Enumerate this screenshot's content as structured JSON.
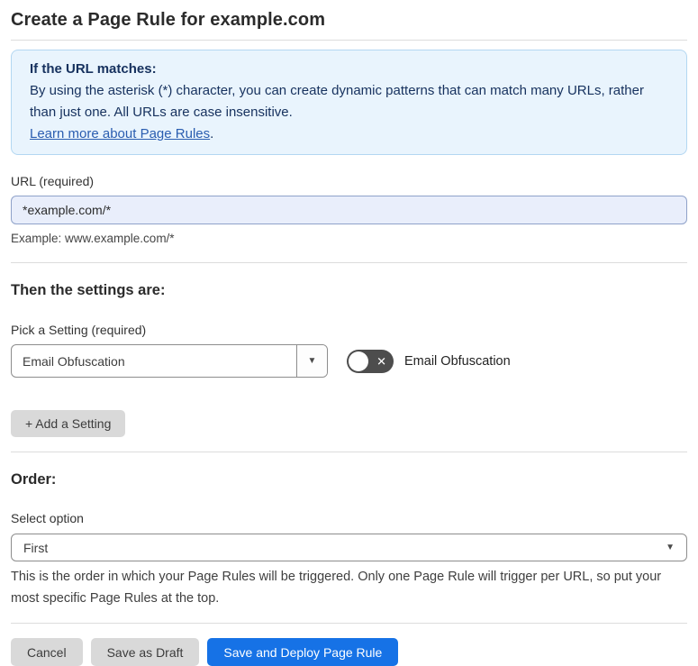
{
  "page": {
    "title": "Create a Page Rule for example.com"
  },
  "info_box": {
    "heading": "If the URL matches:",
    "body": "By using the asterisk (*) character, you can create dynamic patterns that can match many URLs, rather than just one. All URLs are case insensitive.",
    "link_text": "Learn more about Page Rules",
    "link_suffix": "."
  },
  "url_section": {
    "label": "URL (required)",
    "value": "*example.com/*",
    "example": "Example: www.example.com/*"
  },
  "settings_section": {
    "heading": "Then the settings are:",
    "pick_label": "Pick a Setting (required)",
    "selected_setting": "Email Obfuscation",
    "dropdown_arrow": "▼",
    "toggle": {
      "state": "off",
      "off_glyph": "✕",
      "label": "Email Obfuscation"
    },
    "add_button_label": "+ Add a Setting"
  },
  "order_section": {
    "heading": "Order:",
    "label": "Select option",
    "selected_option": "First",
    "dropdown_arrow": "▼",
    "help_text": "This is the order in which your Page Rules will be triggered. Only one Page Rule will trigger per URL, so put your most specific Page Rules at the top."
  },
  "footer": {
    "cancel_label": "Cancel",
    "save_draft_label": "Save as Draft",
    "save_deploy_label": "Save and Deploy Page Rule"
  },
  "colors": {
    "info_box_bg": "#e9f4fd",
    "info_box_border": "#b3d7f2",
    "info_box_text": "#16315e",
    "link": "#2a5db0",
    "url_input_bg": "#e9eefb",
    "url_input_border": "#8fa2c9",
    "toggle_off_bg": "#4d4d4d",
    "gray_button_bg": "#d9d9d9",
    "primary_button_bg": "#1672e6"
  }
}
